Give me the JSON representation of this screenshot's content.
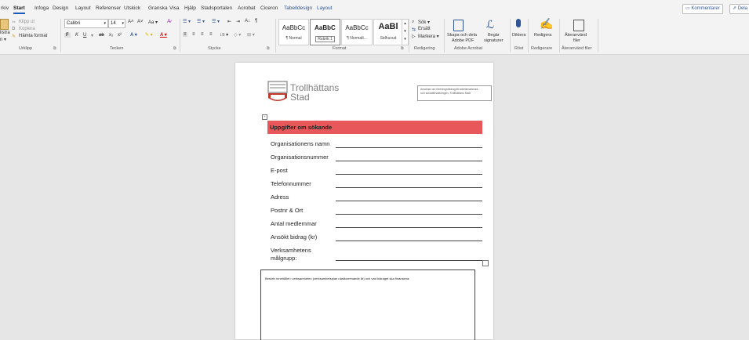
{
  "tabs": [
    "Arkiv",
    "Start",
    "Infoga",
    "Design",
    "Layout",
    "Referenser",
    "Utskick",
    "Granska",
    "Visa",
    "Hjälp",
    "Stadsportalen",
    "Acrobat",
    "Ciceron",
    "Tabelldesign",
    "Layout"
  ],
  "tabs_shown": [
    "rkiv",
    "Start",
    "Infoga",
    "Design",
    "Layout",
    "Referenser",
    "Utskick",
    "Granska",
    "Visa",
    "Hjälp",
    "Stadsportalen",
    "Acrobat",
    "Ciceron",
    "Tabelldesign",
    "Layout"
  ],
  "top_right": {
    "comments": "Kommentarer",
    "share": "Dela"
  },
  "ribbon": {
    "clipboard": {
      "paste": "listra",
      "paste_sub": "n ▾",
      "cut": "Klipp ut",
      "copy": "Kopiera",
      "format_painter": "Hämta format",
      "label": "Urklipp"
    },
    "font": {
      "name": "Calibri",
      "size": "14",
      "label": "Tecken",
      "grow": "A˄",
      "shrink": "A˅",
      "case": "Aa ▾"
    },
    "paragraph": {
      "label": "Stycke"
    },
    "styles": {
      "label": "Format",
      "items": [
        {
          "sample": "AaBbCc",
          "name": "¶ Normal"
        },
        {
          "sample": "AaBbC",
          "name": "Rubrik 1"
        },
        {
          "sample": "AaBbCc",
          "name": "¶ Normalt..."
        },
        {
          "sample": "AaBl",
          "name": "Sidhuvud"
        }
      ]
    },
    "editing": {
      "find": "Sök ▾",
      "replace": "Ersätt",
      "select": "Markera ▾",
      "label": "Redigering"
    },
    "adobe": {
      "create_share": "Skapa och dela",
      "create_share2": "Adobe PDF",
      "request": "Begär",
      "request2": "signaturer",
      "label": "Adobe Acrobat"
    },
    "voice": {
      "dictate": "Diktera",
      "label": "Röst"
    },
    "editor": {
      "edit": "Redigera",
      "label": "Redigerare"
    },
    "reuse": {
      "reuse": "Återanvänd",
      "reuse2": "filer",
      "label": "Återanvänd filer"
    }
  },
  "document": {
    "logo_line1": "Trollhättans",
    "logo_line2": "Stad",
    "header_box_line1": "Ansökan om föreningsbidrag till arbetsmarknad-",
    "header_box_line2": "och socialförvaltningen, Trollhättans Stad",
    "section_title": "Uppgifter om sökande",
    "fields": [
      "Organisationens namn",
      "Organisationsnummer",
      "E-post",
      "Telefonnummer",
      "Adress",
      "Postnr & Ort",
      "Antal medlemmar",
      "Ansökt bidrag (kr)"
    ],
    "target_group_line1": "Verksamhetens",
    "target_group_line2": "målgrupp:",
    "description_prompt": "Beskriv innehållet i verksamheten (verksamhetsplan nästkommande år) och vad bidraget ska finansiera:"
  },
  "colors": {
    "accent": "#185abd",
    "section_header": "#e8585a",
    "tab_blue": "#2f5597"
  }
}
